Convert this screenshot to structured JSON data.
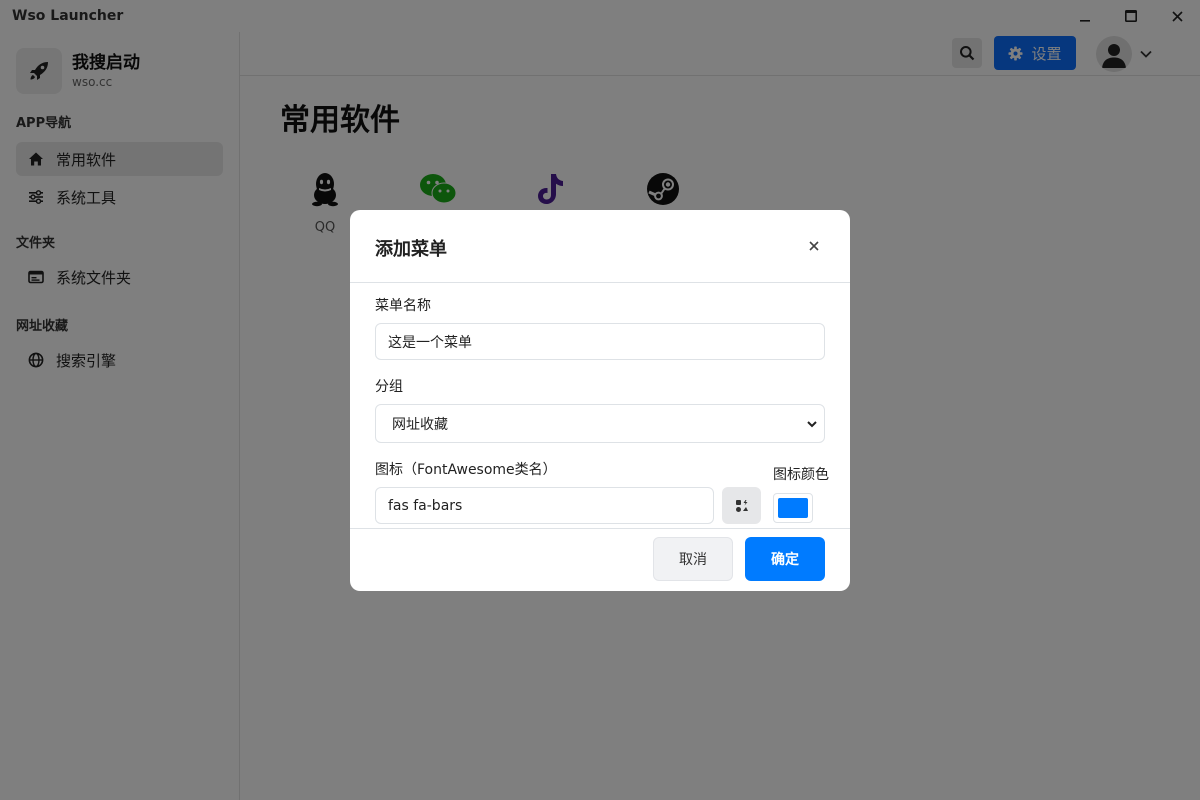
{
  "window": {
    "title": "Wso Launcher"
  },
  "brand": {
    "name": "我搜启动",
    "sub": "wso.cc"
  },
  "sidebar": {
    "groups": [
      {
        "heading": "APP导航",
        "items": [
          {
            "label": "常用软件"
          },
          {
            "label": "系统工具"
          }
        ]
      },
      {
        "heading": "文件夹",
        "items": [
          {
            "label": "系统文件夹"
          }
        ]
      },
      {
        "heading": "网址收藏",
        "items": [
          {
            "label": "搜索引擎"
          }
        ]
      }
    ]
  },
  "header": {
    "settings_label": "设置"
  },
  "main": {
    "title": "常用软件",
    "apps": [
      {
        "label": "QQ"
      },
      {
        "label": ""
      },
      {
        "label": ""
      },
      {
        "label": ""
      }
    ]
  },
  "modal": {
    "title": "添加菜单",
    "name_label": "菜单名称",
    "name_value": "这是一个菜单",
    "group_label": "分组",
    "group_value": "网址收藏",
    "icon_label": "图标（FontAwesome类名）",
    "icon_value": "fas fa-bars",
    "color_label": "图标颜色",
    "color_value": "#007bff",
    "cancel_label": "取消",
    "ok_label": "确定"
  },
  "colors": {
    "accent": "#0d6efd",
    "primary_button": "#007bff",
    "wechat": "#1aad19",
    "tiktok": "#4b1d95"
  }
}
